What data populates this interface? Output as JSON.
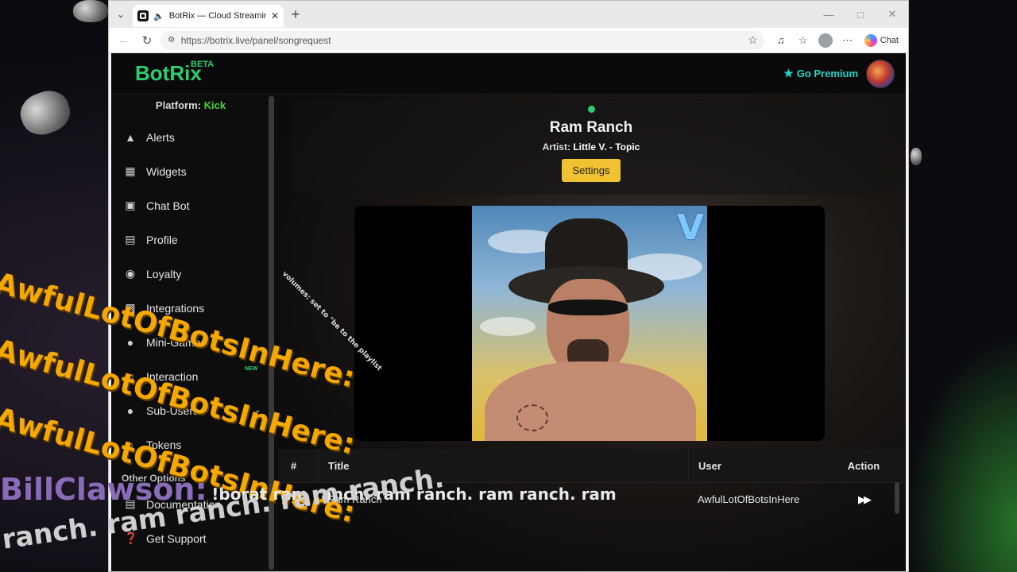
{
  "browser": {
    "tab_title": "BotRix — Cloud Streaming Bo",
    "url": "https://botrix.live/panel/songrequest",
    "chat_label": "Chat",
    "icons": [
      "tab-actions-icon",
      "speaker-icon",
      "close-icon",
      "new-tab-icon",
      "minimize-icon",
      "maximize-icon",
      "window-close-icon",
      "back-icon",
      "refresh-icon",
      "site-info-icon",
      "favorite-star-icon",
      "read-aloud-icon",
      "favorites-icon",
      "profile-icon",
      "more-icon",
      "copilot-icon"
    ]
  },
  "app": {
    "brand": "BotRix",
    "brand_badge": "BETA",
    "premium_label": "Go Premium",
    "colors": {
      "brand": "#2ecc71",
      "premium": "#27d3c8",
      "settings_button": "#f1c232"
    }
  },
  "sidebar": {
    "platform_label": "Platform:",
    "platform_value": "Kick",
    "items": [
      {
        "label": "Alerts",
        "icon": "warning-icon"
      },
      {
        "label": "Widgets",
        "icon": "grid-icon"
      },
      {
        "label": "Chat Bot",
        "icon": "robot-icon"
      },
      {
        "label": "Profile",
        "icon": "id-card-icon"
      },
      {
        "label": "Loyalty",
        "icon": "trophy-icon"
      },
      {
        "label": "Integrations",
        "icon": "puzzle-icon"
      },
      {
        "label": "Mini-Games",
        "icon": "gamepad-icon"
      },
      {
        "label": "Interaction",
        "icon": "music-icon",
        "badge": "NEW"
      },
      {
        "label": "Sub-Users",
        "icon": "users-icon"
      },
      {
        "label": "Tokens",
        "icon": "key-icon"
      }
    ],
    "other_title": "Other Options",
    "other_items": [
      {
        "label": "Documentation",
        "icon": "book-icon"
      },
      {
        "label": "Get Support",
        "icon": "question-icon"
      }
    ]
  },
  "now_playing": {
    "title": "Ram Ranch",
    "artist_label": "Artist:",
    "artist": "Little V. - Topic",
    "settings_label": "Settings"
  },
  "queue": {
    "headers": {
      "num": "#",
      "title": "Title",
      "user": "User",
      "action": "Action"
    },
    "rows": [
      {
        "num": "1",
        "title": "Ram Ranch",
        "user": "AwfulLotOfBotsInHere",
        "action_icon": "skip-forward-icon"
      }
    ]
  },
  "overlay": {
    "bot_name": "AwfulLotOfBotsInHere:",
    "bill_name": "BillClawson:",
    "bill_message": "!borat ram ranch. ram ranch. ram ranch. ram",
    "ranch_text": "ranch. ram ranch. ram ranch.",
    "small_text": "volumes: set to \"be to the playlist"
  }
}
